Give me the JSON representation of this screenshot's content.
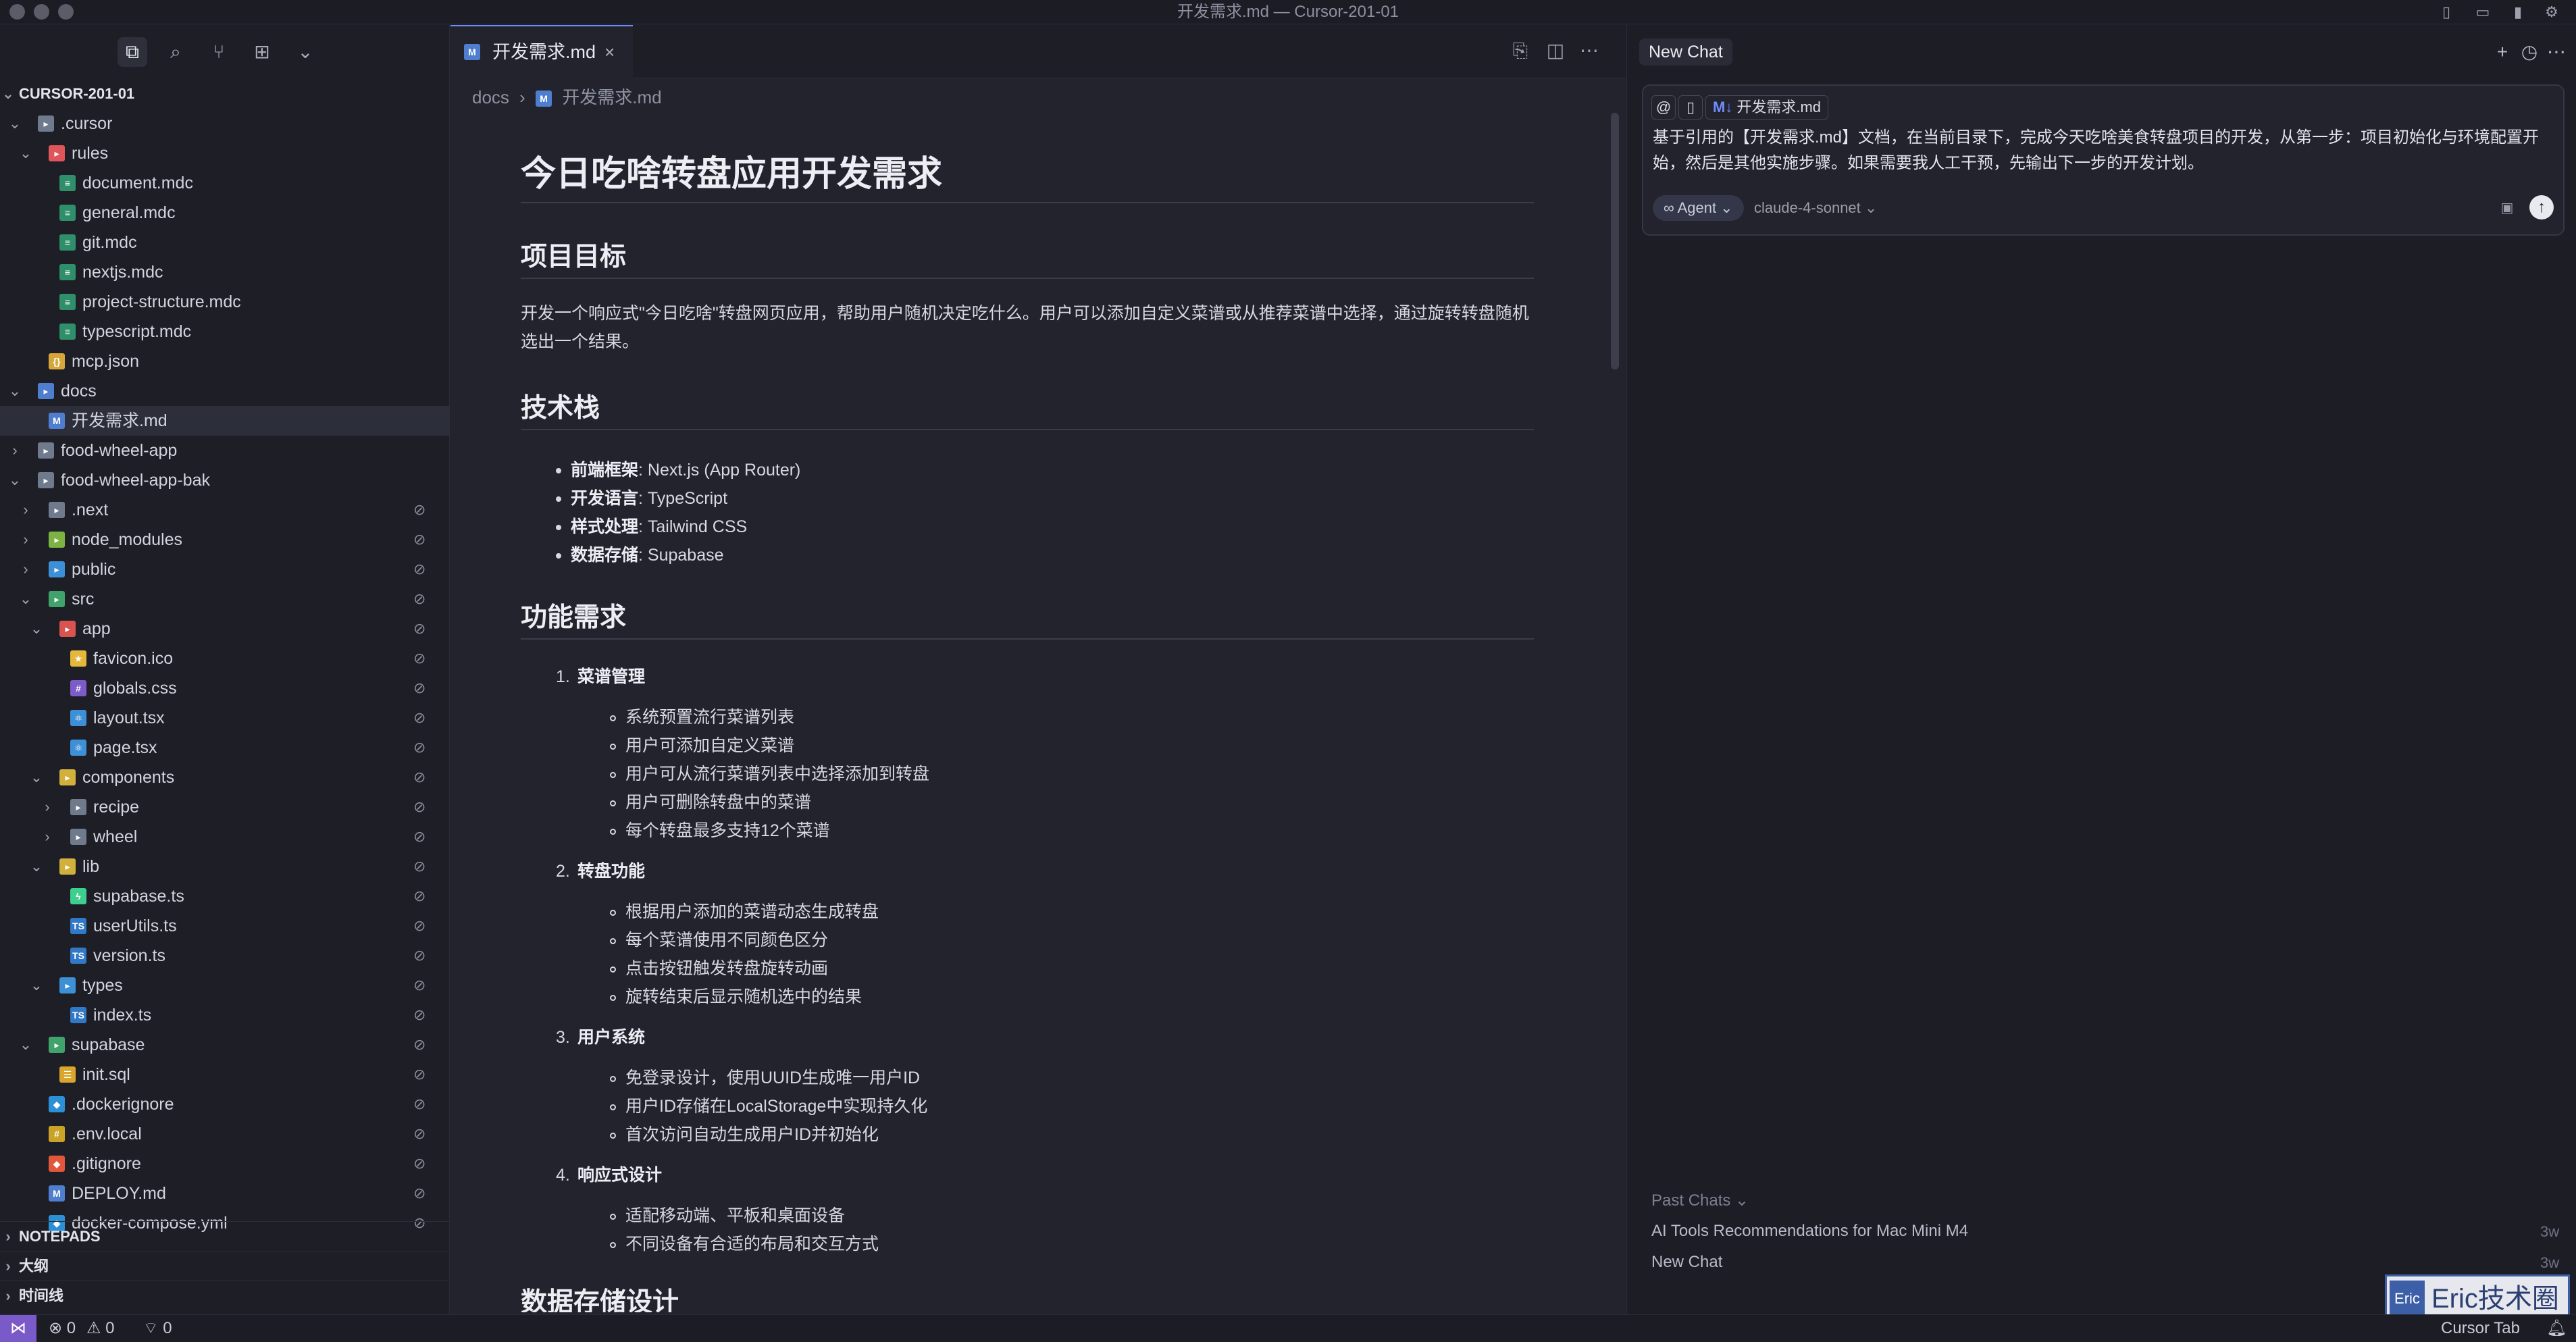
{
  "window": {
    "title": "开发需求.md — Cursor-201-01"
  },
  "explorer": {
    "root": "CURSOR-201-01",
    "items": [
      {
        "name": ".cursor",
        "chev": "⌄",
        "icon_color": "#6f7a8c",
        "icon_glyph": "▸"
      },
      {
        "name": "rules",
        "chev": "⌄",
        "icon_color": "#e0555a",
        "icon_glyph": "▸"
      },
      {
        "name": "document.mdc",
        "chev": "",
        "icon_color": "#2f8f6a",
        "icon_glyph": "≡"
      },
      {
        "name": "general.mdc",
        "chev": "",
        "icon_color": "#2f8f6a",
        "icon_glyph": "≡"
      },
      {
        "name": "git.mdc",
        "chev": "",
        "icon_color": "#2f8f6a",
        "icon_glyph": "≡"
      },
      {
        "name": "nextjs.mdc",
        "chev": "",
        "icon_color": "#2f8f6a",
        "icon_glyph": "≡"
      },
      {
        "name": "project-structure.mdc",
        "chev": "",
        "icon_color": "#2f8f6a",
        "icon_glyph": "≡"
      },
      {
        "name": "typescript.mdc",
        "chev": "",
        "icon_color": "#2f8f6a",
        "icon_glyph": "≡"
      },
      {
        "name": "mcp.json",
        "chev": "",
        "icon_color": "#d7a63a",
        "icon_glyph": "{}"
      },
      {
        "name": "docs",
        "chev": "⌄",
        "icon_color": "#4f7ecf",
        "icon_glyph": "▸"
      },
      {
        "name": "开发需求.md",
        "chev": "",
        "icon_color": "#4f7ecf",
        "icon_glyph": "M"
      },
      {
        "name": "food-wheel-app",
        "chev": "›",
        "icon_color": "#6f7a8c",
        "icon_glyph": "▸"
      },
      {
        "name": "food-wheel-app-bak",
        "chev": "⌄",
        "icon_color": "#6f7a8c",
        "icon_glyph": "▸"
      },
      {
        "name": ".next",
        "chev": "›",
        "icon_color": "#6f7a8c",
        "icon_glyph": "▸"
      },
      {
        "name": "node_modules",
        "chev": "›",
        "icon_color": "#7cb342",
        "icon_glyph": "▸"
      },
      {
        "name": "public",
        "chev": "›",
        "icon_color": "#3d8fd6",
        "icon_glyph": "▸"
      },
      {
        "name": "src",
        "chev": "⌄",
        "icon_color": "#3fa36b",
        "icon_glyph": "▸"
      },
      {
        "name": "app",
        "chev": "⌄",
        "icon_color": "#d9534f",
        "icon_glyph": "▸"
      },
      {
        "name": "favicon.ico",
        "chev": "",
        "icon_color": "#e5b73b",
        "icon_glyph": "★"
      },
      {
        "name": "globals.css",
        "chev": "",
        "icon_color": "#7b5cc9",
        "icon_glyph": "#"
      },
      {
        "name": "layout.tsx",
        "chev": "",
        "icon_color": "#3d8fd6",
        "icon_glyph": "⚛"
      },
      {
        "name": "page.tsx",
        "chev": "",
        "icon_color": "#3d8fd6",
        "icon_glyph": "⚛"
      },
      {
        "name": "components",
        "chev": "⌄",
        "icon_color": "#d2b03c",
        "icon_glyph": "▸"
      },
      {
        "name": "recipe",
        "chev": "›",
        "icon_color": "#6f7a8c",
        "icon_glyph": "▸"
      },
      {
        "name": "wheel",
        "chev": "›",
        "icon_color": "#6f7a8c",
        "icon_glyph": "▸"
      },
      {
        "name": "lib",
        "chev": "⌄",
        "icon_color": "#d2b03c",
        "icon_glyph": "▸"
      },
      {
        "name": "supabase.ts",
        "chev": "",
        "icon_color": "#3ecf8e",
        "icon_glyph": "ϟ"
      },
      {
        "name": "userUtils.ts",
        "chev": "",
        "icon_color": "#3178c6",
        "icon_glyph": "TS"
      },
      {
        "name": "version.ts",
        "chev": "",
        "icon_color": "#3178c6",
        "icon_glyph": "TS"
      },
      {
        "name": "types",
        "chev": "⌄",
        "icon_color": "#3d8fd6",
        "icon_glyph": "▸"
      },
      {
        "name": "index.ts",
        "chev": "",
        "icon_color": "#3178c6",
        "icon_glyph": "TS"
      },
      {
        "name": "supabase",
        "chev": "⌄",
        "icon_color": "#3fa36b",
        "icon_glyph": "▸"
      },
      {
        "name": "init.sql",
        "chev": "",
        "icon_color": "#d9a52b",
        "icon_glyph": "☰"
      },
      {
        "name": ".dockerignore",
        "chev": "",
        "icon_color": "#2d8fd6",
        "icon_glyph": "◆"
      },
      {
        "name": ".env.local",
        "chev": "",
        "icon_color": "#c9a227",
        "icon_glyph": "#"
      },
      {
        "name": ".gitignore",
        "chev": "",
        "icon_color": "#e2573b",
        "icon_glyph": "◆"
      },
      {
        "name": "DEPLOY.md",
        "chev": "",
        "icon_color": "#4f7ecf",
        "icon_glyph": "M"
      },
      {
        "name": "docker-compose.yml",
        "chev": "",
        "icon_color": "#2d8fd6",
        "icon_glyph": "◆"
      }
    ],
    "sections": [
      "NOTEPADS",
      "大纲",
      "时间线"
    ]
  },
  "editor": {
    "tab_label": "开发需求.md",
    "breadcrumb": {
      "folder": "docs",
      "sep": "›",
      "file": "开发需求.md"
    },
    "doc": {
      "h1": "今日吃啥转盘应用开发需求",
      "s1_title": "项目目标",
      "s1_para": "开发一个响应式\"今日吃啥\"转盘网页应用，帮助用户随机决定吃什么。用户可以添加自定义菜谱或从推荐菜谱中选择，通过旋转转盘随机选出一个结果。",
      "s2_title": "技术栈",
      "tech": [
        {
          "k": "前端框架",
          "v": ": Next.js (App Router)"
        },
        {
          "k": "开发语言",
          "v": ": TypeScript"
        },
        {
          "k": "样式处理",
          "v": ": Tailwind CSS"
        },
        {
          "k": "数据存储",
          "v": ": Supabase"
        }
      ],
      "s3_title": "功能需求",
      "groups": [
        {
          "num": "1.",
          "title": "菜谱管理",
          "items": [
            "系统预置流行菜谱列表",
            "用户可添加自定义菜谱",
            "用户可从流行菜谱列表中选择添加到转盘",
            "用户可删除转盘中的菜谱",
            "每个转盘最多支持12个菜谱"
          ]
        },
        {
          "num": "2.",
          "title": "转盘功能",
          "items": [
            "根据用户添加的菜谱动态生成转盘",
            "每个菜谱使用不同颜色区分",
            "点击按钮触发转盘旋转动画",
            "旋转结束后显示随机选中的结果"
          ]
        },
        {
          "num": "3.",
          "title": "用户系统",
          "items": [
            "免登录设计，使用UUID生成唯一用户ID",
            "用户ID存储在LocalStorage中实现持久化",
            "首次访问自动生成用户ID并初始化"
          ]
        },
        {
          "num": "4.",
          "title": "响应式设计",
          "items": [
            "适配移动端、平板和桌面设备",
            "不同设备有合适的布局和交互方式"
          ]
        }
      ],
      "s4_title": "数据存储设计"
    }
  },
  "chat": {
    "tab_label": "New Chat",
    "context_chip": "开发需求.md",
    "message": "基于引用的【开发需求.md】文档，在当前目录下，完成今天吃啥美食转盘项目的开发，从第一步：项目初始化与环境配置开始，然后是其他实施步骤。如果需要我人工干预，先输出下一步的开发计划。",
    "mode": "∞ Agent ⌄",
    "model": "claude-4-sonnet ⌄",
    "past_chats_label": "Past Chats ⌄",
    "history": [
      {
        "title": "AI Tools Recommendations for Mac Mini M4",
        "age": "3w"
      },
      {
        "title": "New Chat",
        "age": "3w"
      }
    ],
    "watermark": {
      "badge": "Eric",
      "text": "Eric技术圈"
    }
  },
  "status": {
    "errors": "⊗ 0",
    "warnings": "⚠ 0",
    "ports": "⌔ 0",
    "cursor_tab": "Cursor Tab"
  }
}
